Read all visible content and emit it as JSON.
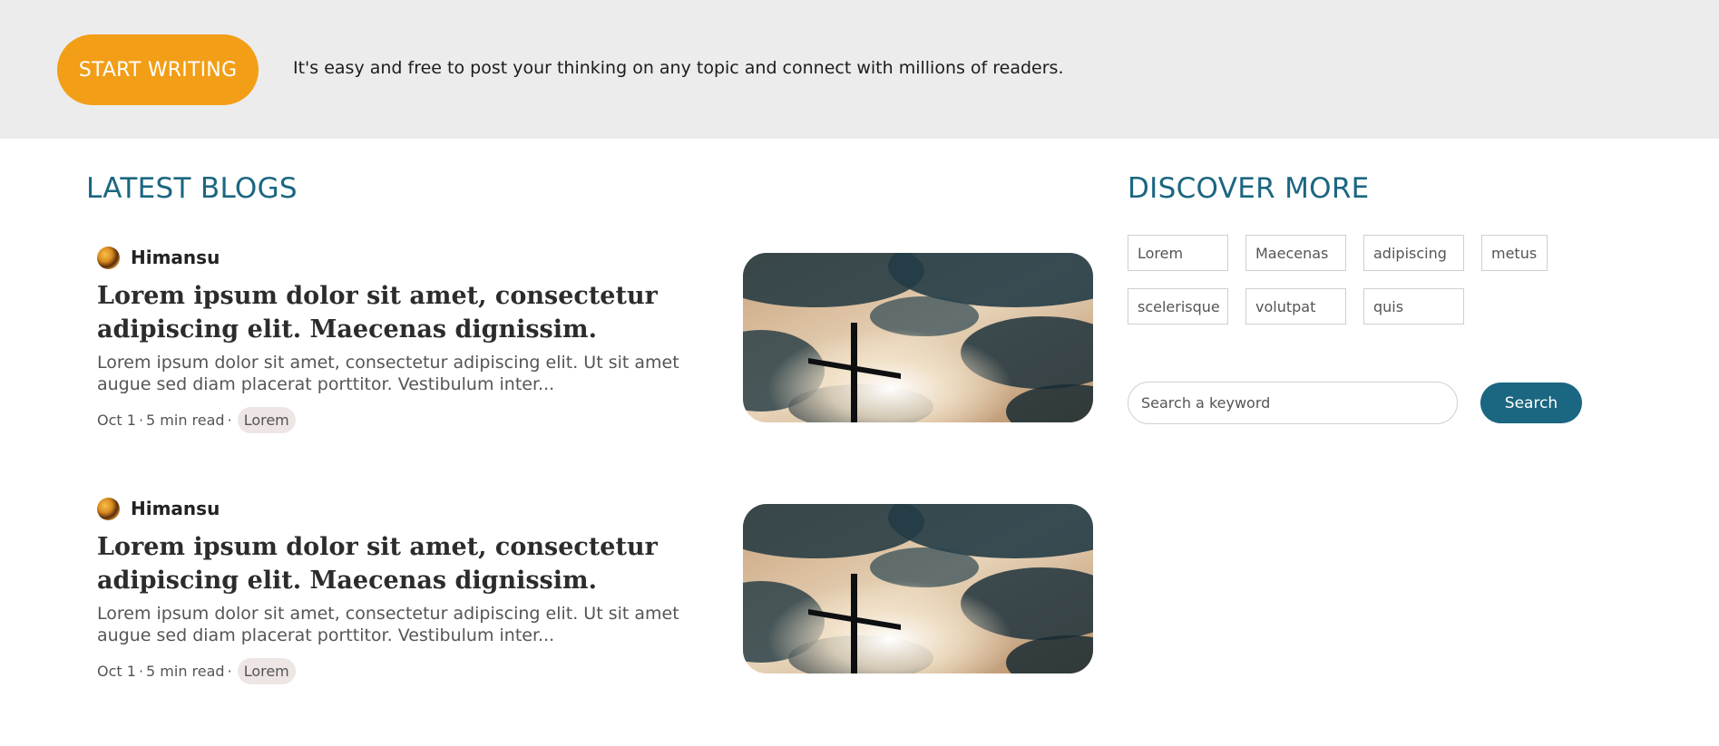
{
  "banner": {
    "cta_label": "START WRITING",
    "tagline": "It's easy and free to post your thinking on any topic and connect with millions of readers."
  },
  "latest": {
    "heading": "LATEST BLOGS",
    "posts": [
      {
        "author": "Himansu",
        "title": "Lorem ipsum dolor sit amet, consectetur adipiscing elit. Maecenas dignissim.",
        "excerpt": "Lorem ipsum dolor sit amet, consectetur adipiscing elit. Ut sit amet augue sed diam placerat porttitor. Vestibulum inter...",
        "date": "Oct 1",
        "read_time": "5 min read",
        "separator": "·",
        "tag": "Lorem"
      },
      {
        "author": "Himansu",
        "title": "Lorem ipsum dolor sit amet, consectetur adipiscing elit. Maecenas dignissim.",
        "excerpt": "Lorem ipsum dolor sit amet, consectetur adipiscing elit. Ut sit amet augue sed diam placerat porttitor. Vestibulum inter...",
        "date": "Oct 1",
        "read_time": "5 min read",
        "separator": "·",
        "tag": "Lorem"
      }
    ]
  },
  "discover": {
    "heading": "DISCOVER MORE",
    "tags": [
      "Lorem",
      "Maecenas",
      "adipiscing",
      "metus",
      "scelerisque",
      "volutpat",
      "quis"
    ]
  },
  "search": {
    "placeholder": "Search a keyword",
    "value": "",
    "button_label": "Search"
  },
  "colors": {
    "accent_orange": "#f29e16",
    "accent_teal": "#1b6680",
    "banner_bg": "#ececec",
    "tag_chip_bg": "#eee5e5"
  }
}
